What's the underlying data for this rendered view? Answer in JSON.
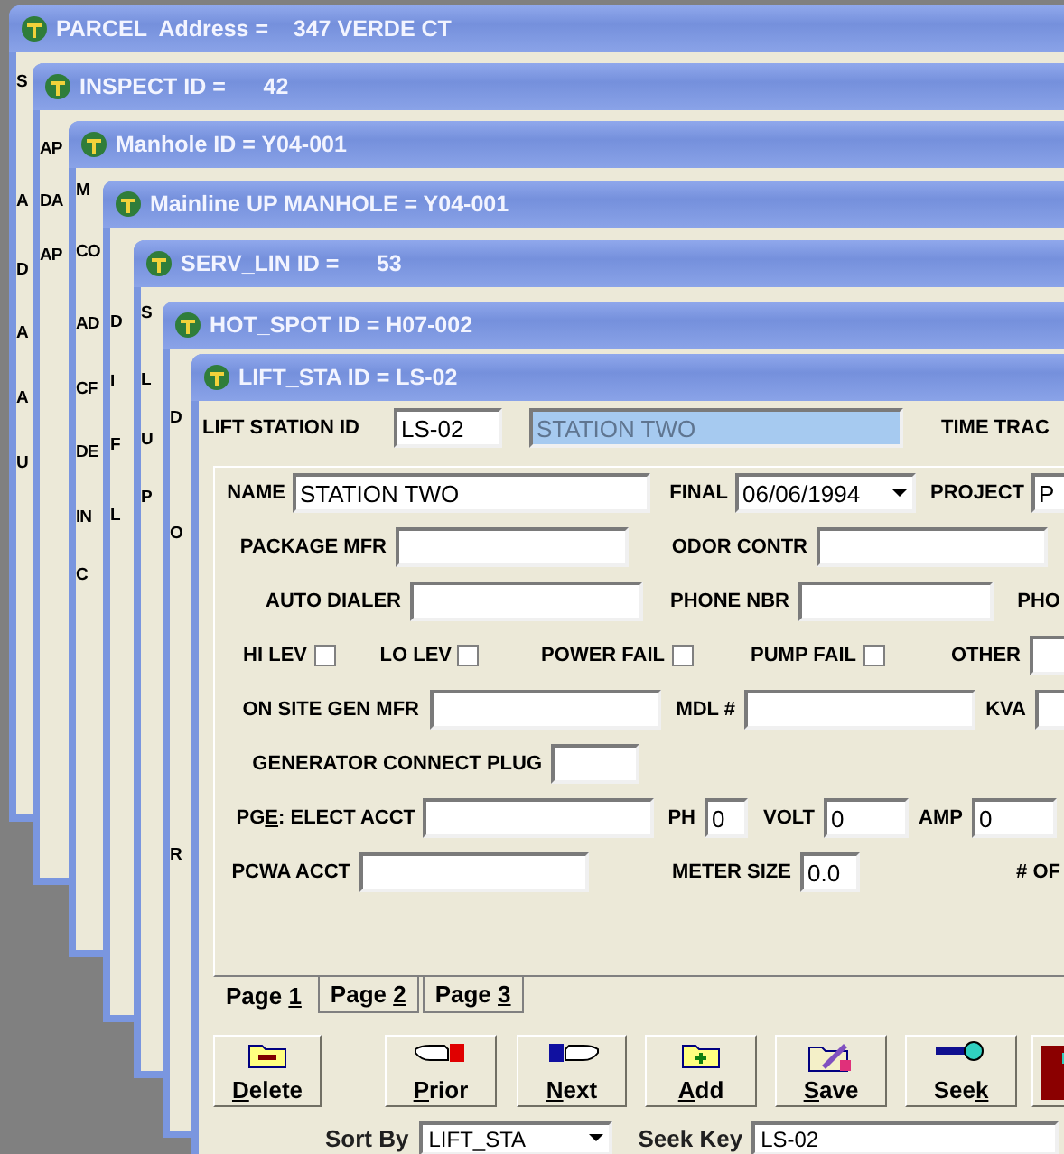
{
  "windows": [
    {
      "title": "PARCEL  Address =    347 VERDE CT",
      "labels": [
        "S",
        "A",
        "D",
        "A",
        "A",
        "U"
      ]
    },
    {
      "title": "INSPECT ID =      42",
      "labels": [
        "AP",
        "DA",
        "AP"
      ]
    },
    {
      "title": "Manhole ID = Y04-001",
      "labels": [
        "M",
        "CO",
        "AD",
        "CF",
        "DE",
        "IN",
        "C"
      ]
    },
    {
      "title": "Mainline UP MANHOLE = Y04-001",
      "labels": [
        "D",
        "I",
        "F",
        "L"
      ]
    },
    {
      "title": "SERV_LIN ID =      53",
      "labels": [
        "S",
        "L",
        "U",
        "P"
      ]
    },
    {
      "title": "HOT_SPOT ID = H07-002",
      "labels": [
        "D",
        "O",
        "R"
      ]
    }
  ],
  "main_window": {
    "title": "LIFT_STA ID = LS-02",
    "header": {
      "id_label": "LIFT STATION ID",
      "id_value": "LS-02",
      "name_value": "STATION TWO",
      "name_disabled": true,
      "time_label": "TIME TRAC"
    },
    "rows": [
      {
        "items": [
          {
            "kind": "label",
            "text": "NAME"
          },
          {
            "kind": "field",
            "value": "STATION TWO"
          },
          {
            "kind": "label",
            "text": "FINAL"
          },
          {
            "kind": "dropdown",
            "value": "06/06/1994"
          },
          {
            "kind": "label",
            "text": "PROJECT"
          },
          {
            "kind": "field",
            "value": "P"
          }
        ]
      },
      {
        "items": [
          {
            "kind": "label",
            "text": "PACKAGE MFR"
          },
          {
            "kind": "field"
          },
          {
            "kind": "label",
            "text": "ODOR CONTR"
          },
          {
            "kind": "field"
          }
        ]
      },
      {
        "items": [
          {
            "kind": "label",
            "text": "AUTO DIALER"
          },
          {
            "kind": "field"
          },
          {
            "kind": "label",
            "text": "PHONE NBR"
          },
          {
            "kind": "field"
          },
          {
            "kind": "label",
            "text": "PHO"
          }
        ]
      },
      {
        "items": [
          {
            "kind": "label",
            "text": "HI LEV"
          },
          {
            "kind": "check",
            "checked": false
          },
          {
            "kind": "label",
            "text": "LO LEV"
          },
          {
            "kind": "check",
            "checked": false
          },
          {
            "kind": "label",
            "text": "POWER FAIL"
          },
          {
            "kind": "check",
            "checked": false
          },
          {
            "kind": "label",
            "text": "PUMP FAIL"
          },
          {
            "kind": "check",
            "checked": false
          },
          {
            "kind": "label",
            "text": "OTHER"
          },
          {
            "kind": "field"
          }
        ]
      },
      {
        "items": [
          {
            "kind": "label",
            "text": "ON SITE GEN MFR"
          },
          {
            "kind": "field"
          },
          {
            "kind": "label",
            "text": "MDL #"
          },
          {
            "kind": "field"
          },
          {
            "kind": "label",
            "text": "KVA"
          },
          {
            "kind": "field"
          }
        ]
      },
      {
        "items": [
          {
            "kind": "label",
            "text": "GENERATOR CONNECT PLUG"
          },
          {
            "kind": "field"
          }
        ]
      },
      {
        "items": [
          {
            "kind": "accel_label",
            "before": "PG",
            "key": "E",
            "after": ": ELECT ACCT"
          },
          {
            "kind": "field"
          },
          {
            "kind": "label",
            "text": "PH"
          },
          {
            "kind": "field",
            "value": "0"
          },
          {
            "kind": "label",
            "text": "VOLT"
          },
          {
            "kind": "field",
            "value": "0"
          },
          {
            "kind": "label",
            "text": "AMP"
          },
          {
            "kind": "field",
            "value": "0"
          }
        ]
      },
      {
        "items": [
          {
            "kind": "label",
            "text": "PCWA ACCT"
          },
          {
            "kind": "field"
          },
          {
            "kind": "label",
            "text": "METER SIZE"
          },
          {
            "kind": "field",
            "value": "0.0"
          },
          {
            "kind": "label",
            "text": "# OF"
          }
        ]
      }
    ],
    "tabs": [
      {
        "before": "Page ",
        "key": "1",
        "selected": true
      },
      {
        "before": "Page ",
        "key": "2",
        "selected": false
      },
      {
        "before": "Page ",
        "key": "3",
        "selected": false
      }
    ],
    "buttons": [
      {
        "key": "D",
        "after": "elete"
      },
      {
        "key": "P",
        "after": "rior"
      },
      {
        "key": "N",
        "after": "ext"
      },
      {
        "key": "A",
        "after": "dd"
      },
      {
        "key": "S",
        "after": "ave"
      },
      {
        "before": "See",
        "key": "k"
      }
    ],
    "sort_by": {
      "label": "Sort By",
      "value": "LIFT_STA"
    },
    "seek_key": {
      "label": "Seek Key",
      "value": "LS-02"
    }
  }
}
